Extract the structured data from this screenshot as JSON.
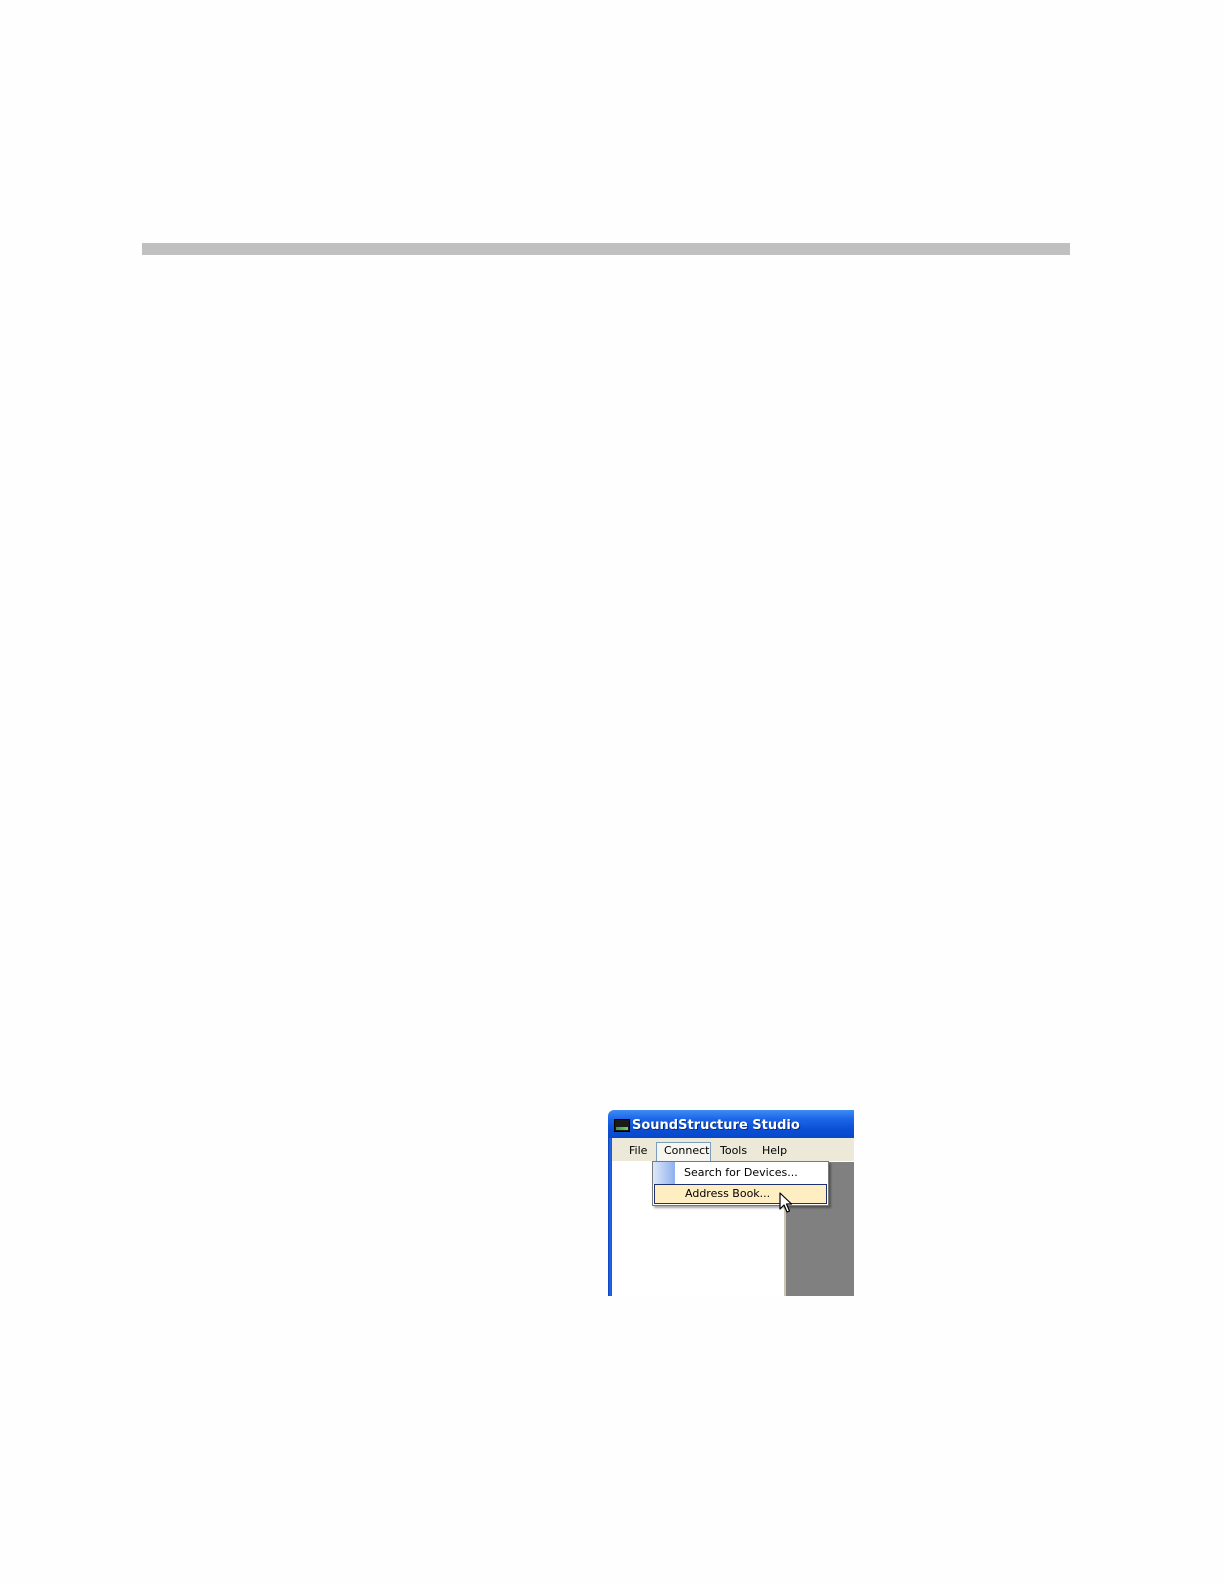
{
  "window": {
    "title": "SoundStructure Studio"
  },
  "menubar": {
    "items": [
      "File",
      "Connect",
      "Tools",
      "Help"
    ]
  },
  "connect_menu": {
    "items": [
      "Search for Devices...",
      "Address Book..."
    ],
    "highlighted": "Address Book..."
  },
  "colors": {
    "titlebar": "#0a4fd6",
    "menubar": "#ece9d8",
    "highlight": "#ffeec2",
    "page_rule": "#c0c0c0"
  }
}
